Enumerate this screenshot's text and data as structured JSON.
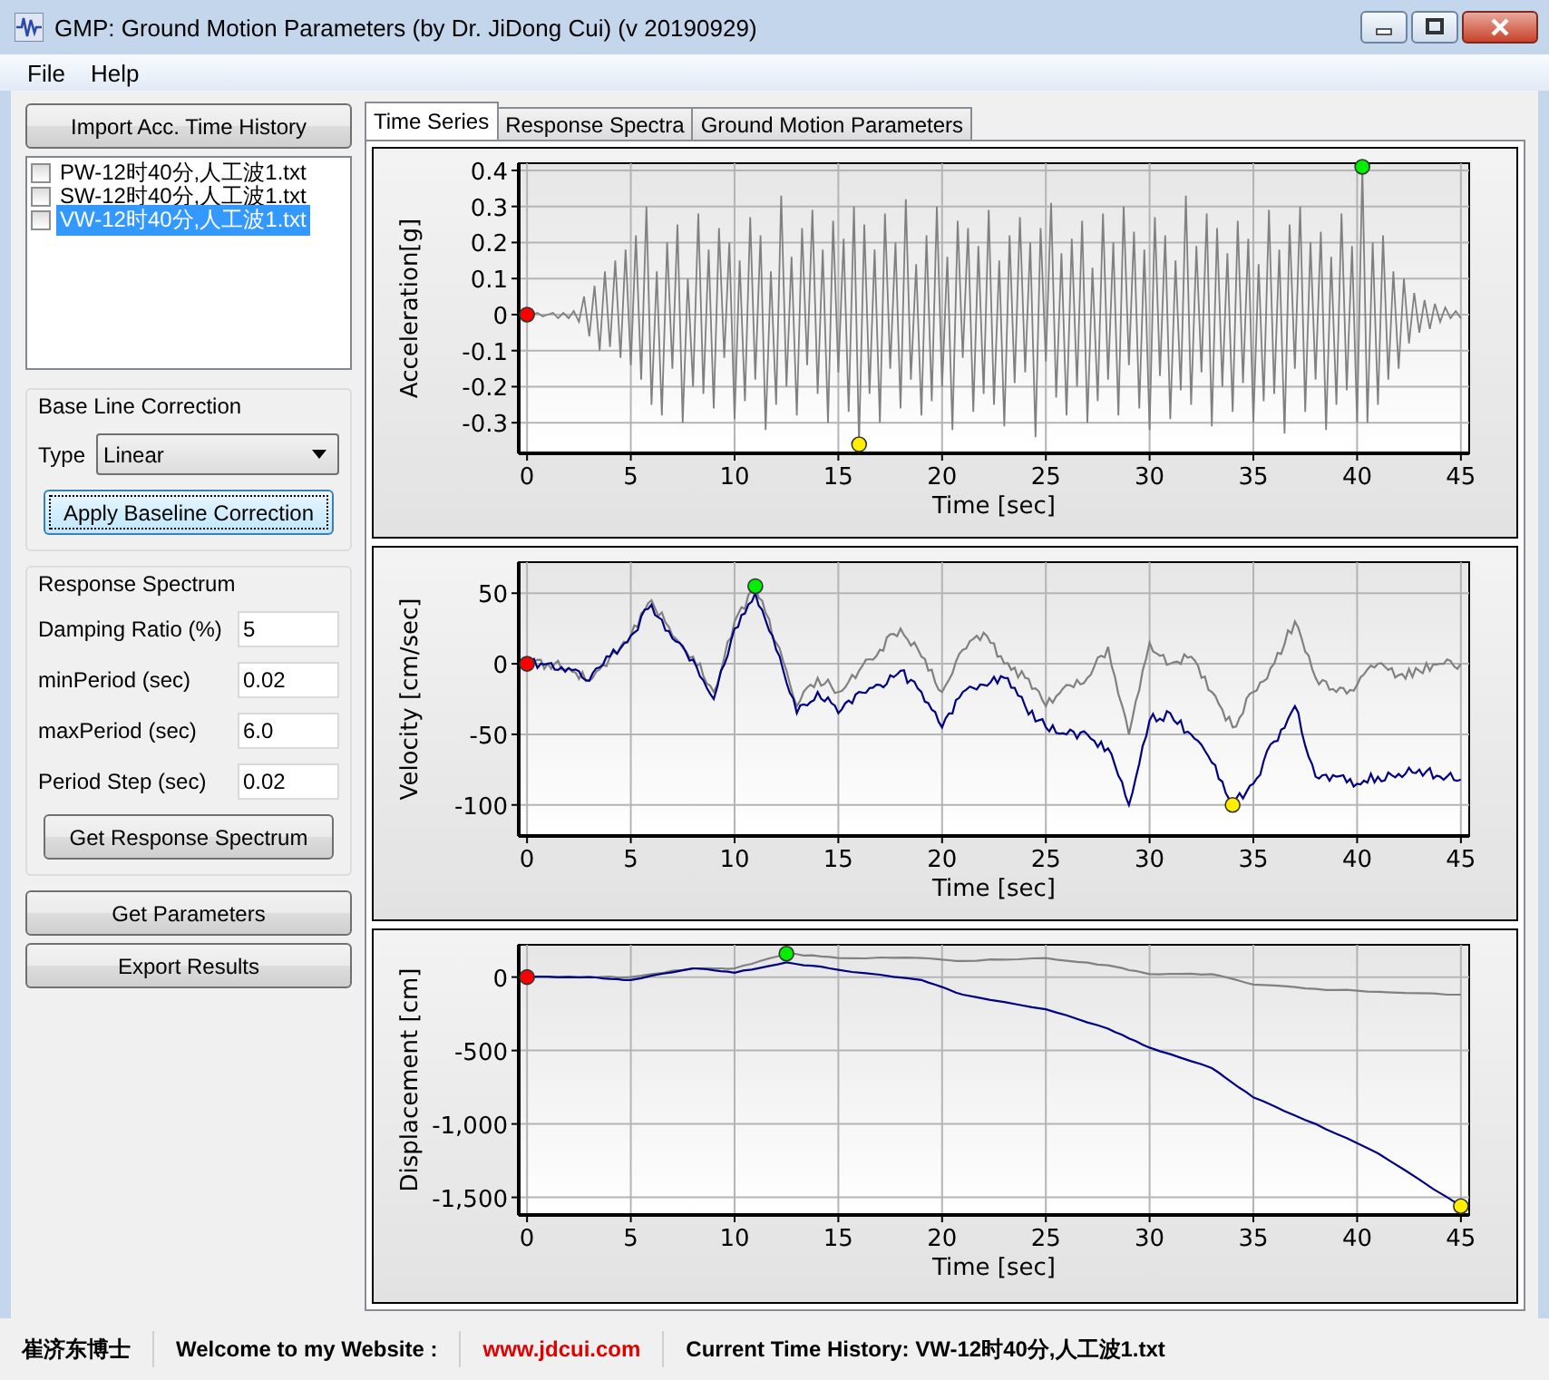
{
  "window": {
    "title": "GMP: Ground Motion Parameters (by Dr. JiDong Cui) (v 20190929)"
  },
  "menu": [
    "File",
    "Help"
  ],
  "import_button": "Import Acc. Time History",
  "files": [
    {
      "name": "PW-12时40分,人工波1.txt",
      "checked": false,
      "selected": false
    },
    {
      "name": "SW-12时40分,人工波1.txt",
      "checked": false,
      "selected": false
    },
    {
      "name": "VW-12时40分,人工波1.txt",
      "checked": false,
      "selected": true
    }
  ],
  "baseline": {
    "title": "Base Line Correction",
    "type_label": "Type",
    "type_value": "Linear",
    "button": "Apply Baseline Correction"
  },
  "spectrum": {
    "title": "Response Spectrum",
    "fields": [
      {
        "label": "Damping Ratio (%)",
        "value": "5"
      },
      {
        "label": "minPeriod (sec)",
        "value": "0.02"
      },
      {
        "label": "maxPeriod (sec)",
        "value": "6.0"
      },
      {
        "label": "Period Step (sec)",
        "value": "0.02"
      }
    ],
    "button": "Get Response Spectrum"
  },
  "buttons": [
    "Get Parameters",
    "Export Results"
  ],
  "tabs": [
    {
      "label": "Time Series",
      "selected": true
    },
    {
      "label": "Response Spectra",
      "selected": false
    },
    {
      "label": "Ground Motion Parameters",
      "selected": false
    }
  ],
  "plots": [
    {
      "kind": "waveform",
      "chart_data": {
        "type": "line",
        "xlabel": "Time [sec]",
        "ylabel": "Acceleration[g]",
        "xlim": [
          -0.4,
          45.4
        ],
        "ylim": [
          -0.385,
          0.42
        ],
        "xticks": [
          0,
          5,
          10,
          15,
          20,
          25,
          30,
          35,
          40,
          45
        ],
        "yticks": [
          -0.3,
          -0.2,
          -0.1,
          0,
          0.1,
          0.2,
          0.3,
          0.4
        ],
        "x": [
          0,
          0.25,
          0.5,
          0.75,
          1,
          1.25,
          1.5,
          1.75,
          2,
          2.25,
          2.5,
          2.75,
          3,
          3.25,
          3.5,
          3.75,
          4,
          4.25,
          4.5,
          4.75,
          5,
          5.25,
          5.5,
          5.75,
          6,
          6.25,
          6.5,
          6.75,
          7,
          7.25,
          7.5,
          7.75,
          8,
          8.25,
          8.5,
          8.75,
          9,
          9.25,
          9.5,
          9.75,
          10,
          10.25,
          10.5,
          10.75,
          11,
          11.25,
          11.5,
          11.75,
          12,
          12.25,
          12.5,
          12.75,
          13,
          13.25,
          13.5,
          13.75,
          14,
          14.25,
          14.5,
          14.75,
          15,
          15.25,
          15.5,
          15.75,
          16,
          16.25,
          16.5,
          16.75,
          17,
          17.25,
          17.5,
          17.75,
          18,
          18.25,
          18.5,
          18.75,
          19,
          19.25,
          19.5,
          19.75,
          20,
          20.25,
          20.5,
          20.75,
          21,
          21.25,
          21.5,
          21.75,
          22,
          22.25,
          22.5,
          22.75,
          23,
          23.25,
          23.5,
          23.75,
          24,
          24.25,
          24.5,
          24.75,
          25,
          25.25,
          25.5,
          25.75,
          26,
          26.25,
          26.5,
          26.75,
          27,
          27.25,
          27.5,
          27.75,
          28,
          28.25,
          28.5,
          28.75,
          29,
          29.25,
          29.5,
          29.75,
          30,
          30.25,
          30.5,
          30.75,
          31,
          31.25,
          31.5,
          31.75,
          32,
          32.25,
          32.5,
          32.75,
          33,
          33.25,
          33.5,
          33.75,
          34,
          34.25,
          34.5,
          34.75,
          35,
          35.25,
          35.5,
          35.75,
          36,
          36.25,
          36.5,
          36.75,
          37,
          37.25,
          37.5,
          37.75,
          38,
          38.25,
          38.5,
          38.75,
          39,
          39.25,
          39.5,
          39.75,
          40,
          40.25,
          40.5,
          40.75,
          41,
          41.25,
          41.5,
          41.75,
          42,
          42.25,
          42.5,
          42.75,
          43,
          43.25,
          43.5,
          43.75,
          44,
          44.25,
          44.5,
          44.75,
          45
        ],
        "series": [
          {
            "color": "#808080",
            "values": [
              0,
              0,
              0.005,
              -0.005,
              0,
              0.005,
              -0.01,
              0.005,
              -0.01,
              0.01,
              -0.02,
              0.05,
              -0.06,
              0.08,
              -0.1,
              0.12,
              -0.09,
              0.15,
              -0.12,
              0.18,
              -0.14,
              0.22,
              -0.18,
              0.3,
              -0.25,
              0.12,
              -0.28,
              0.2,
              -0.15,
              0.25,
              -0.3,
              0.1,
              -0.2,
              0.28,
              -0.22,
              0.18,
              -0.26,
              0.24,
              -0.12,
              0.2,
              -0.29,
              0.15,
              -0.24,
              0.27,
              -0.18,
              0.22,
              -0.32,
              0.12,
              -0.25,
              0.33,
              -0.2,
              0.16,
              -0.28,
              0.24,
              -0.14,
              0.29,
              -0.22,
              0.18,
              -0.3,
              0.26,
              -0.16,
              0.21,
              -0.27,
              0.3,
              -0.36,
              0.25,
              -0.22,
              0.18,
              -0.3,
              0.28,
              -0.15,
              0.2,
              -0.26,
              0.32,
              -0.18,
              0.14,
              -0.28,
              0.22,
              -0.24,
              0.3,
              -0.2,
              0.16,
              -0.32,
              0.26,
              -0.12,
              0.24,
              -0.27,
              0.19,
              -0.22,
              0.29,
              -0.25,
              0.15,
              -0.31,
              0.22,
              -0.19,
              0.27,
              -0.16,
              0.2,
              -0.34,
              0.24,
              -0.13,
              0.31,
              -0.23,
              0.17,
              -0.28,
              0.21,
              -0.2,
              0.26,
              -0.3,
              0.13,
              -0.24,
              0.28,
              -0.18,
              0.2,
              -0.28,
              0.3,
              -0.14,
              0.23,
              -0.26,
              0.18,
              -0.32,
              0.27,
              -0.17,
              0.22,
              -0.29,
              0.15,
              -0.21,
              0.33,
              -0.25,
              0.19,
              -0.16,
              0.28,
              -0.31,
              0.24,
              -0.2,
              0.17,
              -0.27,
              0.26,
              -0.19,
              0.21,
              -0.3,
              0.14,
              -0.24,
              0.29,
              -0.22,
              0.18,
              -0.33,
              0.25,
              -0.15,
              0.3,
              -0.27,
              0.2,
              -0.18,
              0.23,
              -0.32,
              0.16,
              -0.25,
              0.28,
              -0.21,
              0.19,
              -0.3,
              0.41,
              -0.3,
              0.2,
              -0.25,
              0.22,
              -0.18,
              0.12,
              -0.15,
              0.1,
              -0.08,
              0.06,
              -0.05,
              0.04,
              -0.04,
              0.03,
              -0.02,
              0.02,
              -0.01,
              0.01,
              -0.01
            ]
          }
        ],
        "grid": true
      }
    },
    {
      "kind": "lines",
      "chart_data": {
        "type": "line",
        "xlabel": "Time [sec]",
        "ylabel": "Velocity [cm/sec]",
        "xlim": [
          -0.4,
          45.4
        ],
        "ylim": [
          -122,
          72
        ],
        "xticks": [
          0,
          5,
          10,
          15,
          20,
          25,
          30,
          35,
          40,
          45
        ],
        "yticks": [
          -100,
          -50,
          0,
          50
        ],
        "x": [
          0,
          1,
          2,
          3,
          4,
          5,
          6,
          7,
          8,
          9,
          10,
          11,
          12,
          13,
          14,
          15,
          16,
          17,
          18,
          19,
          20,
          21,
          22,
          23,
          24,
          25,
          26,
          27,
          28,
          29,
          30,
          31,
          32,
          33,
          34,
          35,
          36,
          37,
          38,
          39,
          40,
          41,
          42,
          43,
          44,
          45
        ],
        "series": [
          {
            "color": "#808080",
            "values": [
              0,
              0,
              -3,
              -12,
              5,
              20,
              45,
              20,
              5,
              -20,
              30,
              55,
              15,
              -30,
              -10,
              -20,
              -5,
              10,
              25,
              5,
              -20,
              10,
              22,
              0,
              -10,
              -30,
              -15,
              -10,
              12,
              -50,
              15,
              0,
              5,
              -20,
              -45,
              -20,
              0,
              30,
              -10,
              -20,
              -15,
              0,
              -8,
              -5,
              0,
              0
            ]
          },
          {
            "color": "#000080",
            "values": [
              0,
              0,
              -3,
              -12,
              5,
              20,
              42,
              18,
              3,
              -25,
              25,
              50,
              10,
              -35,
              -20,
              -35,
              -20,
              -15,
              -5,
              -20,
              -45,
              -20,
              -15,
              -10,
              -30,
              -45,
              -50,
              -50,
              -60,
              -100,
              -40,
              -35,
              -50,
              -70,
              -100,
              -85,
              -55,
              -30,
              -80,
              -80,
              -85,
              -80,
              -78,
              -75,
              -80,
              -82
            ]
          }
        ],
        "grid": true
      }
    },
    {
      "kind": "lines",
      "chart_data": {
        "type": "line",
        "xlabel": "Time [sec]",
        "ylabel": "Displacement [cm]",
        "xlim": [
          -0.4,
          45.4
        ],
        "ylim": [
          -1620,
          220
        ],
        "xticks": [
          0,
          5,
          10,
          15,
          20,
          25,
          30,
          35,
          40,
          45
        ],
        "yticks": [
          {
            "value": -1500,
            "label": "-1,500"
          },
          {
            "value": -1000,
            "label": "-1,000"
          },
          {
            "value": -500,
            "label": "-500"
          },
          {
            "value": 0,
            "label": "0"
          }
        ],
        "x": [
          0,
          3,
          5,
          8,
          10,
          12.5,
          15,
          19,
          21,
          25,
          28,
          30,
          33,
          35,
          38,
          41,
          45
        ],
        "series": [
          {
            "color": "#808080",
            "values": [
              0,
              0,
              0,
              60,
              60,
              160,
              130,
              130,
              110,
              130,
              80,
              20,
              20,
              -50,
              -80,
              -100,
              -120
            ]
          },
          {
            "color": "#000080",
            "values": [
              0,
              0,
              -20,
              60,
              30,
              100,
              50,
              -20,
              -120,
              -220,
              -350,
              -480,
              -620,
              -820,
              -1000,
              -1200,
              -1560
            ]
          }
        ],
        "grid": true
      }
    }
  ],
  "status_bar": {
    "author": "崔济东博士",
    "welcome": "Welcome to my Website :",
    "website": "www.jdcui.com",
    "current": "Current Time History: VW-12时40分,人工波1.txt"
  }
}
